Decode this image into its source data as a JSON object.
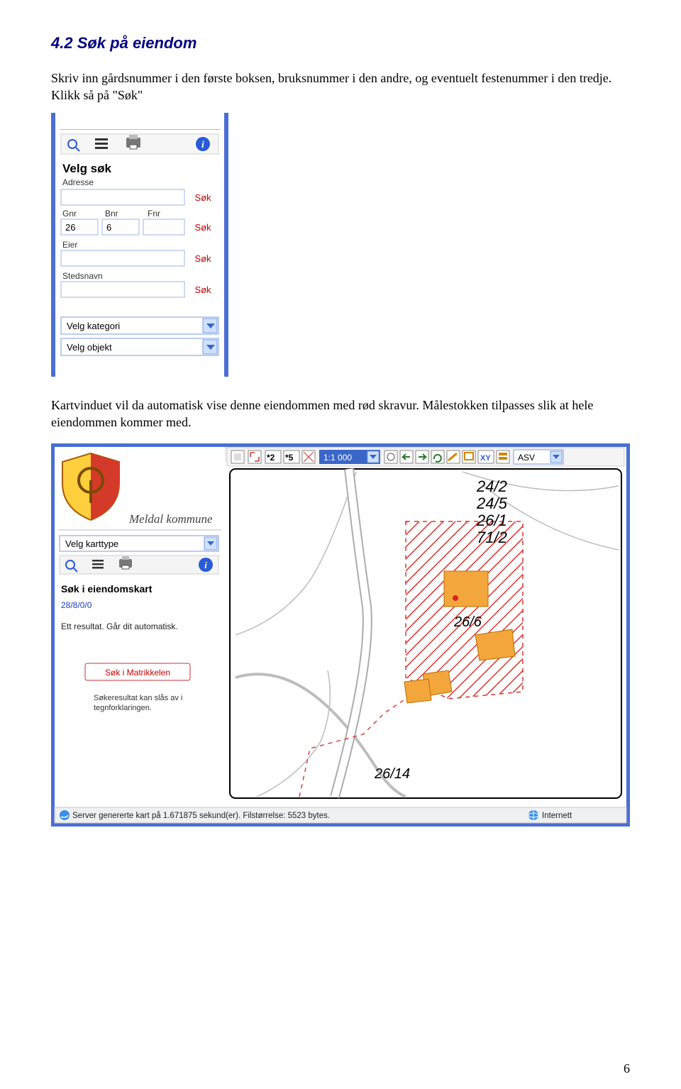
{
  "section": {
    "title": "4.2 Søk på eiendom"
  },
  "para1": "Skriv inn gårdsnummer i den første boksen, bruksnummer i den andre, og eventuelt festenummer i den tredje. Klikk så på \"Søk\"",
  "para2": "Kartvinduet vil da automatisk vise denne eiendommen med rød skravur. Målestokken tilpasses slik at hele eiendommen kommer med.",
  "page_number": "6",
  "panel": {
    "title": "Velg søk",
    "labels": {
      "adresse": "Adresse",
      "gnr": "Gnr",
      "bnr": "Bnr",
      "fnr": "Fnr",
      "eier": "Eier",
      "stedsnavn": "Stedsnavn"
    },
    "values": {
      "gnr": "26",
      "bnr": "6",
      "fnr": ""
    },
    "sok": "Søk",
    "select1": "Velg kategori",
    "select2": "Velg objekt"
  },
  "map": {
    "kommune": "Meldal kommune",
    "karttype_placeholder": "Velg karttype",
    "side_title": "Søk i eiendomskart",
    "side_sub": "28/8/0/0",
    "side_result": "Ett resultat. Går dit automatisk.",
    "side_btn": "Søk i Matrikkelen",
    "side_hint": "Søkeresultat kan slås av i tegnforklaringen.",
    "scale": "1:1 000",
    "coord": "ASV",
    "parcels_stack": [
      "24/2",
      "24/5",
      "26/1",
      "71/2"
    ],
    "center_parcel": "26/6",
    "left_parcel": "26/14",
    "status": "Server genererte kart på 1.671875 sekund(er). Filstørrelse: 5523 bytes.",
    "status_right": "Internett"
  }
}
